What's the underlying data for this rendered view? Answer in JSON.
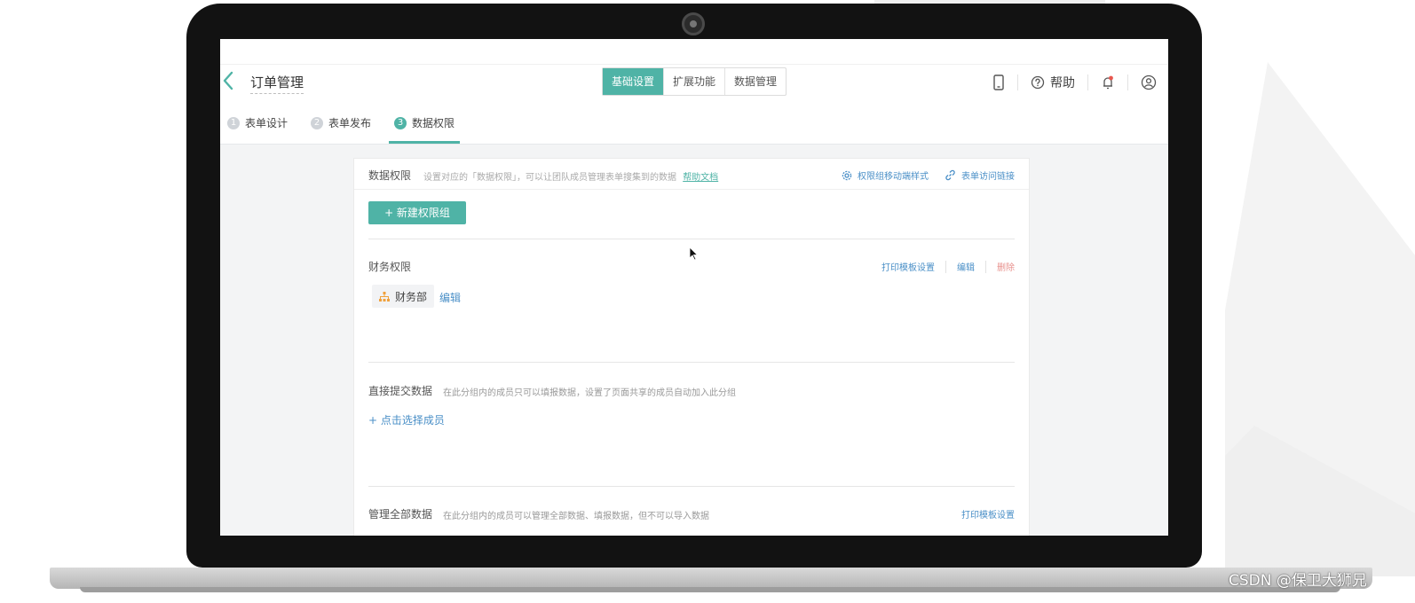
{
  "app": {
    "title": "订单管理"
  },
  "header": {
    "tabs": [
      {
        "label": "基础设置",
        "active": true
      },
      {
        "label": "扩展功能",
        "active": false
      },
      {
        "label": "数据管理",
        "active": false
      }
    ],
    "help_label": "帮助",
    "icons": [
      "mobile-preview-icon",
      "help-circle-icon",
      "notification-bell-icon",
      "user-avatar-icon"
    ]
  },
  "steps": [
    {
      "num": "1",
      "label": "表单设计",
      "active": false
    },
    {
      "num": "2",
      "label": "表单发布",
      "active": false
    },
    {
      "num": "3",
      "label": "数据权限",
      "active": true
    }
  ],
  "panel": {
    "title": "数据权限",
    "description": "设置对应的「数据权限」，可以让团队成员管理表单搜集到的数据",
    "help_link": "帮助文档",
    "mobile_style": "权限组移动端样式",
    "access_link": "表单访问链接",
    "new_group_button": "+ 新建权限组"
  },
  "groups": {
    "finance": {
      "title": "财务权限",
      "print_settings": "打印模板设置",
      "edit": "编辑",
      "delete": "删除",
      "department": "财务部",
      "department_edit": "编辑"
    },
    "direct_submit": {
      "title": "直接提交数据",
      "description": "在此分组内的成员只可以填报数据，设置了页面共享的成员自动加入此分组",
      "add_member": "+ 点击选择成员"
    },
    "manage_all": {
      "title": "管理全部数据",
      "description": "在此分组内的成员可以管理全部数据、填报数据，但不可以导入数据",
      "print_settings": "打印模板设置"
    }
  },
  "colors": {
    "accent": "#4fb3a6",
    "link": "#4a8fc7",
    "danger": "#e8918d",
    "department_icon": "#f0a13c"
  },
  "watermark": "CSDN @保卫大狮兄"
}
